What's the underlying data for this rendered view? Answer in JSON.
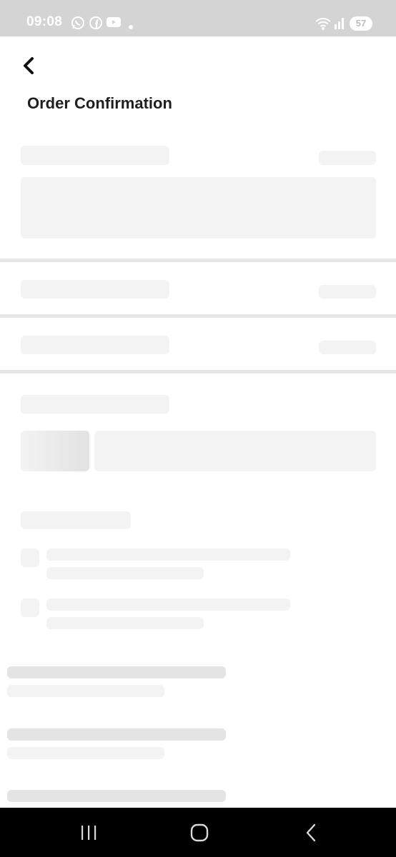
{
  "status_bar": {
    "time": "09:08",
    "battery": "57",
    "icons": [
      "whatsapp-icon",
      "facebook-icon",
      "youtube-icon",
      "dot-icon",
      "wifi-icon",
      "signal-icon",
      "battery-icon"
    ]
  },
  "header": {
    "title": "Order Confirmation",
    "back_icon": "chevron-left-icon"
  },
  "nav_bar": {
    "icons": [
      "recents-icon",
      "home-icon",
      "back-icon"
    ]
  },
  "colors": {
    "status_bar_bg": "#d4d4d4",
    "skeleton": "#f3f3f3",
    "skeleton_dark": "#e4e4e4",
    "divider": "#e6e6e6",
    "nav_bar_bg": "#000000"
  }
}
